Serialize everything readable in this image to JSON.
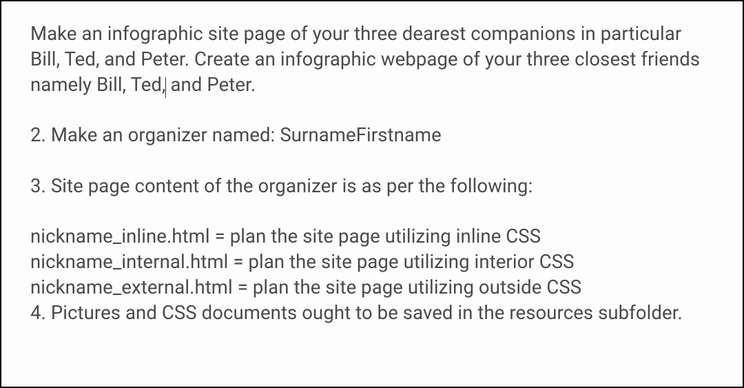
{
  "paragraphs": {
    "p1a": "Make an infographic site page of your three dearest companions in particular Bill, Ted, and Peter. Create an infographic webpage of your three closest friends namely Bill, Ted,",
    "p1b": " and Peter.",
    "p2": "2. Make an organizer named: SurnameFirstname",
    "p3": "3. Site page content of the organizer is as per the following:",
    "p4_l1": "nickname_inline.html = plan the site page utilizing inline CSS",
    "p4_l2": "nickname_internal.html = plan the site page utilizing interior CSS",
    "p4_l3": "nickname_external.html = plan the site page utilizing outside CSS",
    "p4_l4": "4. Pictures and CSS documents ought to be saved in the resources subfolder."
  }
}
